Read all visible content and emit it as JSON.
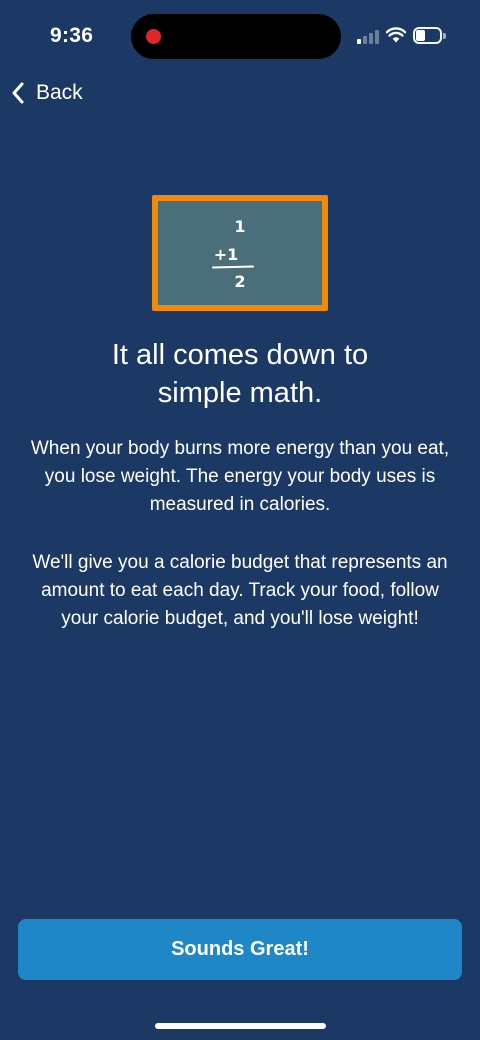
{
  "status_bar": {
    "time": "9:36",
    "recording_color": "#e0262a",
    "icons": [
      "cellular-signal-icon",
      "wifi-icon",
      "battery-icon"
    ]
  },
  "nav": {
    "back_label": "Back",
    "back_icon": "chevron-left-icon"
  },
  "illustration": {
    "name": "chalkboard",
    "line_1": "1",
    "line_2": "+1",
    "line_3": "2",
    "frame_color": "#f08a0c",
    "board_color": "#4a6e7a"
  },
  "content": {
    "headline_line_1": "It all comes down to",
    "headline_line_2": "simple math.",
    "paragraph_1": "When your body burns more energy than you eat, you lose weight. The energy your body uses is measured in calories.",
    "paragraph_2": "We'll give you a calorie budget that represents an amount to eat each day. Track your food, follow your calorie budget, and you'll lose weight!"
  },
  "footer": {
    "primary_button_label": "Sounds Great!",
    "primary_button_color": "#1f86c8"
  },
  "colors": {
    "background": "#1c3966",
    "text": "#ffffff"
  }
}
